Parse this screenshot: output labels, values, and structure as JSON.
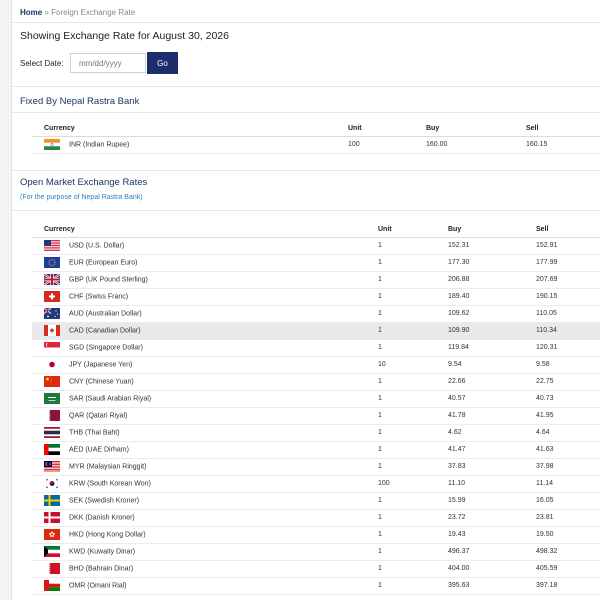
{
  "breadcrumb": {
    "home": "Home",
    "separator": "»",
    "current": "Foreign Exchange Rate"
  },
  "heading": "Showing Exchange Rate for August 30, 2026",
  "date_form": {
    "label": "Select Date:",
    "placeholder": "mm/dd/yyyy",
    "value": "",
    "go_label": "Go"
  },
  "fixed": {
    "title": "Fixed By Nepal Rastra Bank",
    "headers": {
      "currency": "Currency",
      "unit": "Unit",
      "buy": "Buy",
      "sell": "Sell"
    },
    "rows": [
      {
        "flag": "in",
        "currency": "INR (Indian Rupee)",
        "unit": "100",
        "buy": "160.00",
        "sell": "160.15"
      }
    ]
  },
  "open": {
    "title": "Open Market Exchange Rates",
    "subtitle": "(For the purpose of Nepal Rastra Bank)",
    "headers": {
      "currency": "Currency",
      "unit": "Unit",
      "buy": "Buy",
      "sell": "Sell"
    },
    "rows": [
      {
        "flag": "us",
        "currency": "USD (U.S. Dollar)",
        "unit": "1",
        "buy": "152.31",
        "sell": "152.91"
      },
      {
        "flag": "eu",
        "currency": "EUR (European Euro)",
        "unit": "1",
        "buy": "177.30",
        "sell": "177.99"
      },
      {
        "flag": "gb",
        "currency": "GBP (UK Pound Sterling)",
        "unit": "1",
        "buy": "206.88",
        "sell": "207.69"
      },
      {
        "flag": "ch",
        "currency": "CHF (Swiss Franc)",
        "unit": "1",
        "buy": "189.40",
        "sell": "190.15"
      },
      {
        "flag": "au",
        "currency": "AUD (Australian Dollar)",
        "unit": "1",
        "buy": "109.62",
        "sell": "110.05"
      },
      {
        "flag": "ca",
        "currency": "CAD (Canadian Dollar)",
        "unit": "1",
        "buy": "109.90",
        "sell": "110.34",
        "highlight": true
      },
      {
        "flag": "sg",
        "currency": "SGD (Singapore Dollar)",
        "unit": "1",
        "buy": "119.84",
        "sell": "120.31"
      },
      {
        "flag": "jp",
        "currency": "JPY (Japanese Yen)",
        "unit": "10",
        "buy": "9.54",
        "sell": "9.58"
      },
      {
        "flag": "cn",
        "currency": "CNY (Chinese Yuan)",
        "unit": "1",
        "buy": "22.66",
        "sell": "22.75"
      },
      {
        "flag": "sa",
        "currency": "SAR (Saudi Arabian Riyal)",
        "unit": "1",
        "buy": "40.57",
        "sell": "40.73"
      },
      {
        "flag": "qa",
        "currency": "QAR (Qatari Riyal)",
        "unit": "1",
        "buy": "41.78",
        "sell": "41.95"
      },
      {
        "flag": "th",
        "currency": "THB (Thai Baht)",
        "unit": "1",
        "buy": "4.62",
        "sell": "4.64"
      },
      {
        "flag": "ae",
        "currency": "AED (UAE Dirham)",
        "unit": "1",
        "buy": "41.47",
        "sell": "41.63"
      },
      {
        "flag": "my",
        "currency": "MYR (Malaysian Ringgit)",
        "unit": "1",
        "buy": "37.83",
        "sell": "37.98"
      },
      {
        "flag": "kr",
        "currency": "KRW (South Korean Won)",
        "unit": "100",
        "buy": "11.10",
        "sell": "11.14"
      },
      {
        "flag": "se",
        "currency": "SEK (Swedish Kroner)",
        "unit": "1",
        "buy": "15.99",
        "sell": "16.05"
      },
      {
        "flag": "dk",
        "currency": "DKK (Danish Kroner)",
        "unit": "1",
        "buy": "23.72",
        "sell": "23.81"
      },
      {
        "flag": "hk",
        "currency": "HKD (Hong Kong Dollar)",
        "unit": "1",
        "buy": "19.43",
        "sell": "19.50"
      },
      {
        "flag": "kw",
        "currency": "KWD (Kuwaity Dinar)",
        "unit": "1",
        "buy": "496.37",
        "sell": "498.32"
      },
      {
        "flag": "bh",
        "currency": "BHD (Bahrain Dinar)",
        "unit": "1",
        "buy": "404.00",
        "sell": "405.59"
      },
      {
        "flag": "om",
        "currency": "OMR (Omani Rial)",
        "unit": "1",
        "buy": "395.63",
        "sell": "397.18"
      }
    ]
  },
  "colors": {
    "navy": "#1d2c6b",
    "link_blue": "#2a82c0",
    "row_highlight": "#e9e9ec"
  }
}
